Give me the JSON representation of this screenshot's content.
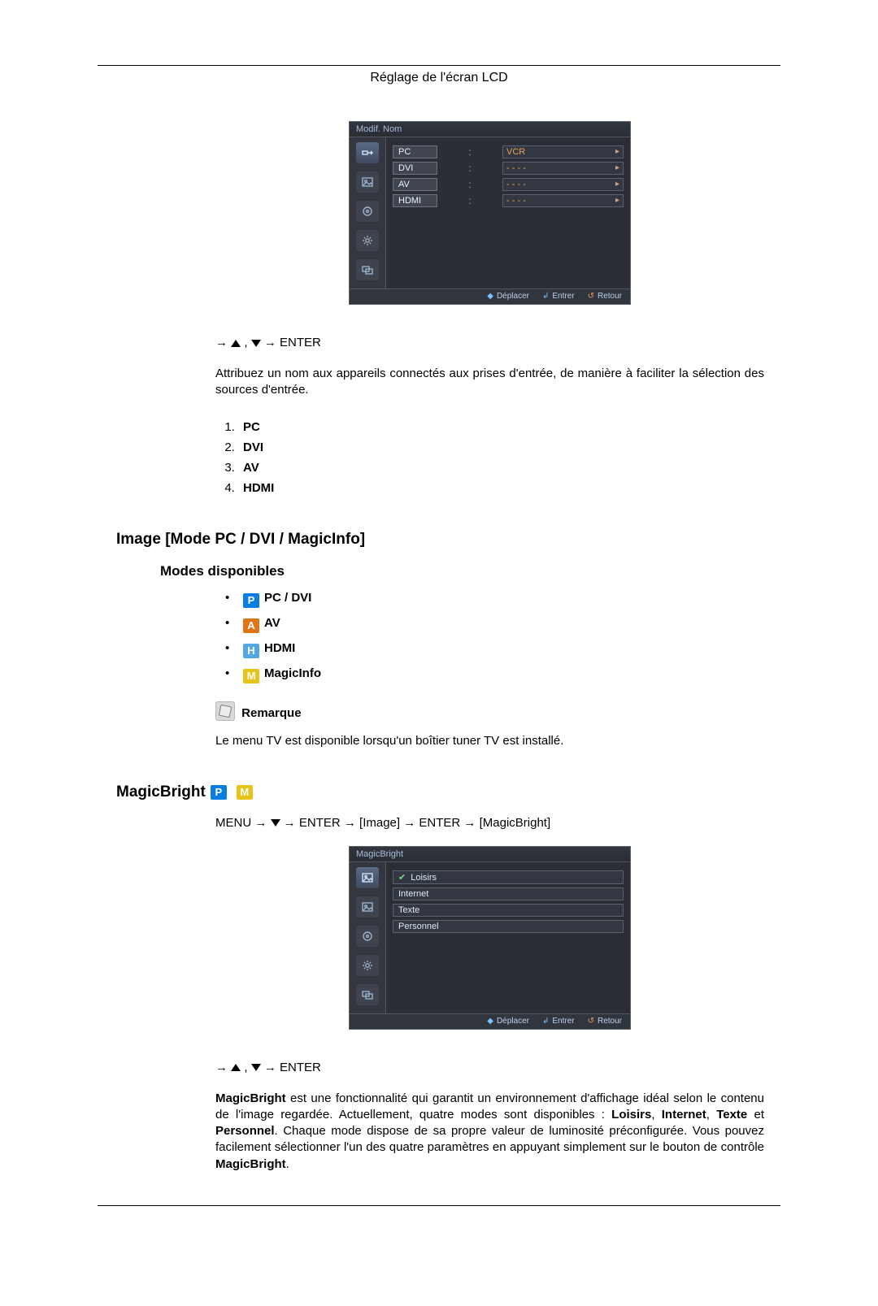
{
  "header": {
    "title": "Réglage de l'écran LCD"
  },
  "osd1": {
    "title": "Modif. Nom",
    "rows": [
      {
        "label": "PC",
        "value": "VCR",
        "arrow": true
      },
      {
        "label": "DVI",
        "value": "- - - -",
        "arrow": true
      },
      {
        "label": "AV",
        "value": "- - - -",
        "arrow": true
      },
      {
        "label": "HDMI",
        "value": "- - - -",
        "arrow": true
      }
    ],
    "footer": {
      "move": "Déplacer",
      "enter": "Entrer",
      "return": "Retour"
    }
  },
  "nav1": {
    "enter": "ENTER"
  },
  "para1": "Attribuez un nom aux appareils connectés aux prises d'entrée, de manière à faciliter la sélection des sources d'entrée.",
  "numlist": [
    "PC",
    "DVI",
    "AV",
    "HDMI"
  ],
  "section1": "Image [Mode PC / DVI / MagicInfo]",
  "sub1": "Modes disponibles",
  "modes": [
    {
      "badge": "P",
      "cls": "b-p",
      "label": "PC / DVI"
    },
    {
      "badge": "A",
      "cls": "b-a",
      "label": "AV"
    },
    {
      "badge": "H",
      "cls": "b-h",
      "label": "HDMI"
    },
    {
      "badge": "M",
      "cls": "b-m",
      "label": "MagicInfo"
    }
  ],
  "note": {
    "label": "Remarque",
    "text": "Le menu TV est disponible lorsqu'un boîtier tuner TV est installé."
  },
  "mb": {
    "heading": "MagicBright",
    "path": {
      "menu": "MENU",
      "enter": "ENTER",
      "image": "[Image]",
      "mb": "[MagicBright]"
    }
  },
  "osd2": {
    "title": "MagicBright",
    "rows": [
      {
        "label": "Loisirs",
        "checked": true
      },
      {
        "label": "Internet"
      },
      {
        "label": "Texte"
      },
      {
        "label": "Personnel"
      }
    ],
    "footer": {
      "move": "Déplacer",
      "enter": "Entrer",
      "return": "Retour"
    }
  },
  "nav2": {
    "enter": "ENTER"
  },
  "para2": {
    "lead": "MagicBright",
    "a": " est une fonctionnalité qui garantit un environnement d'affichage idéal selon le contenu de l'image regardée. Actuellement, quatre modes sont disponibles : ",
    "m1": "Loisirs",
    "m2": "Internet",
    "m3": "Texte",
    "m4": "Personnel",
    "b": ". Chaque mode dispose de sa propre valeur de luminosité préconfigurée. Vous pouvez facilement sélectionner l'un des quatre paramètres en appuyant simplement sur le bouton de contrôle ",
    "btn": "MagicBright",
    "c": "."
  }
}
